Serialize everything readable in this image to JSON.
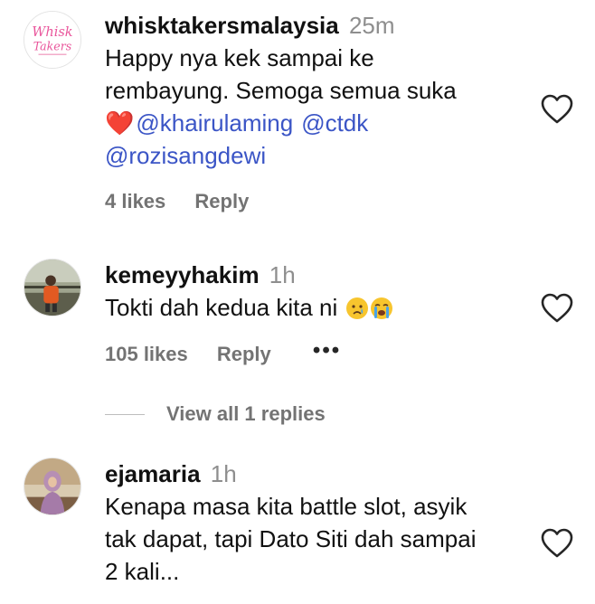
{
  "comments": [
    {
      "username": "whisktakersmalaysia",
      "time": "25m",
      "avatar_text_1": "Whisk",
      "avatar_text_2": "Takers",
      "line1": "Happy nya kek sampai ke",
      "line2": "rembayung. Semoga semua suka",
      "heart_emoji": "❤️",
      "mentions": [
        "@khairulaming",
        "@ctdk",
        "@rozisangdewi"
      ],
      "likes": "4 likes",
      "reply": "Reply"
    },
    {
      "username": "kemeyyhakim",
      "time": "1h",
      "text": "Tokti dah kedua kita ni",
      "emojis": [
        "crying-face-emoji",
        "loudly-crying-face-emoji"
      ],
      "likes": "105 likes",
      "reply": "Reply",
      "more": "•••",
      "view_replies": "View all 1 replies"
    },
    {
      "username": "ejamaria",
      "time": "1h",
      "line1": "Kenapa masa kita battle slot, asyik",
      "line2": "tak dapat, tapi Dato Siti dah sampai",
      "line3": "2 kali..."
    }
  ],
  "colors": {
    "mention": "#3b55c6",
    "muted": "#737373",
    "heart": "#d9162b"
  }
}
